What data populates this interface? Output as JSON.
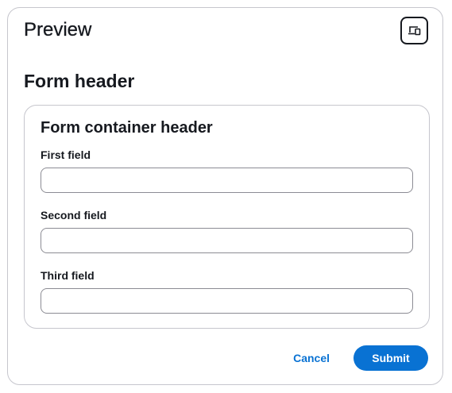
{
  "preview": {
    "title": "Preview",
    "icon": "preview-mode-icon"
  },
  "form": {
    "header": "Form header",
    "container": {
      "header": "Form container header",
      "fields": [
        {
          "label": "First field",
          "value": "",
          "placeholder": ""
        },
        {
          "label": "Second field",
          "value": "",
          "placeholder": ""
        },
        {
          "label": "Third field",
          "value": "",
          "placeholder": ""
        }
      ]
    },
    "actions": {
      "cancel_label": "Cancel",
      "submit_label": "Submit"
    }
  },
  "colors": {
    "accent": "#0972d3",
    "text": "#16191f",
    "border": "#c6c6cd",
    "input_border": "#8c8c94"
  }
}
